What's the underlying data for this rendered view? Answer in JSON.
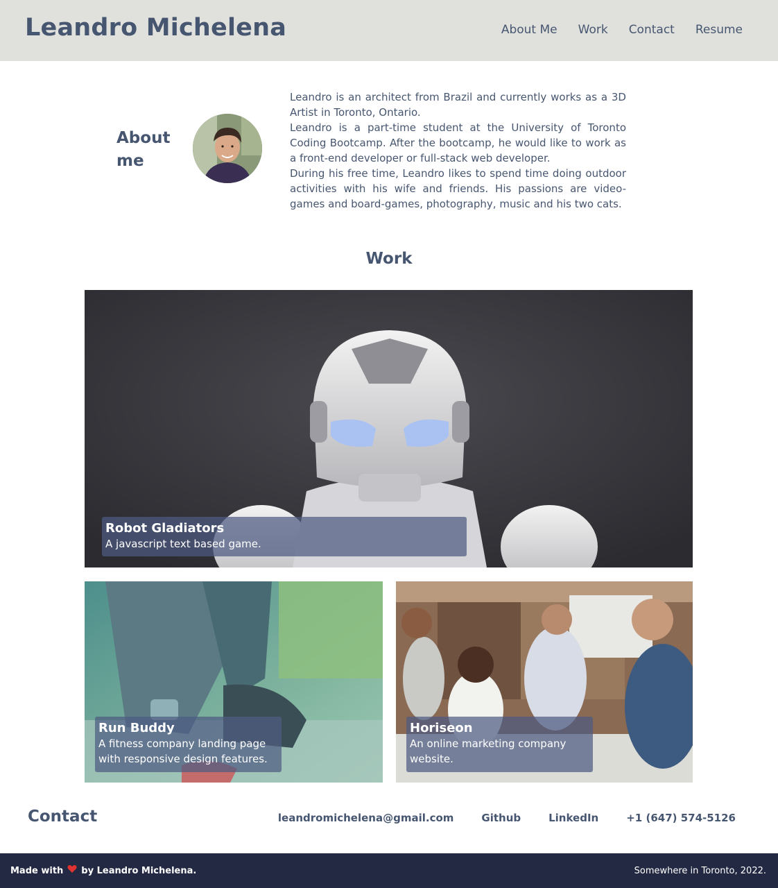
{
  "header": {
    "title": "Leandro Michelena",
    "nav": [
      "About Me",
      "Work",
      "Contact",
      "Resume"
    ]
  },
  "about": {
    "heading": "About me",
    "avatar_icon": "profile-photo",
    "paragraphs": [
      "Leandro is an architect from Brazil and currently works as a 3D Artist in Toronto, Ontario.",
      "Leandro is a part-time student at the University of Toronto Coding Bootcamp. After the bootcamp, he would like to work as a front-end developer or full-stack web developer.",
      "During his free time, Leandro likes to spend time doing outdoor activities with his wife and friends. His passions are video-games and board-games, photography, music and his two cats."
    ]
  },
  "work": {
    "heading": "Work",
    "projects": [
      {
        "title": "Robot Gladiators",
        "description": "A javascript text based game."
      },
      {
        "title": "Run Buddy",
        "description": "A fitness company landing page with responsive design features."
      },
      {
        "title": "Horiseon",
        "description": "An online marketing company website."
      }
    ]
  },
  "contact": {
    "heading": "Contact",
    "links": [
      "leandromichelena@gmail.com",
      "Github",
      "LinkedIn",
      "+1 (647) 574-5126"
    ]
  },
  "footer": {
    "made_with": "Made with",
    "by_text": "by Leandro Michelena.",
    "location": "Somewhere in Toronto, 2022."
  },
  "colors": {
    "primary": "#475670",
    "header_bg": "#e0e1dd",
    "footer_bg": "#232943",
    "caption_bg": "#4e5c82"
  }
}
